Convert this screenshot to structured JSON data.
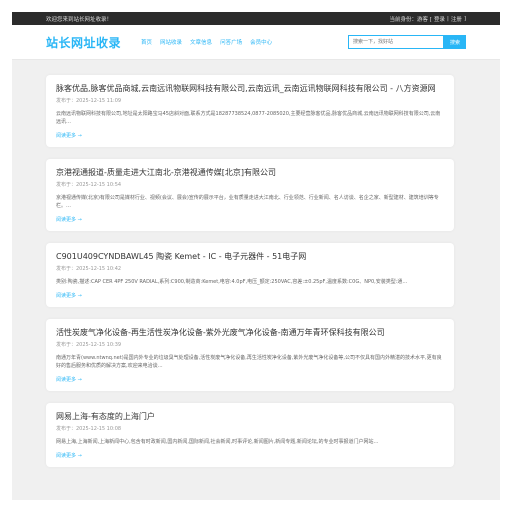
{
  "topbar": {
    "welcome": "欢迎您来到站长网址收录！",
    "identity": "当前身份：游客 [",
    "login": "登录",
    "separator": "|",
    "register": "注册",
    "close": "]"
  },
  "header": {
    "logo": "站长网址收录",
    "nav": [
      "首页",
      "网站收录",
      "文章信息",
      "问答广场",
      "会员中心"
    ],
    "search_placeholder": "搜索一下，找好站",
    "search_button": "搜索"
  },
  "articles": [
    {
      "title": "脉客优品,脉客优品商城,云南远讯物联网科技有限公司,云南远讯_云南远讯物联网科技有限公司 - 八方资源网",
      "date": "发布于：2025-12-15 11:09",
      "desc": "云南远讯物联网科技有限公司,地址是太阳路宝马45店斜对面,联系方式是18287738524,0877-2085020,主要经营脉客优品,脉客优品商城,云南远讯物联网科技有限公司,云南远讯…",
      "more": "阅读更多 →"
    },
    {
      "title": "京港视通报道-质量走进大江南北-京港视通传媒[北京]有限公司",
      "date": "发布于：2025-12-15 10:54",
      "desc": "京港视通传媒(北京)有限公司是媒材行业、视频(会议、展会)宣传的展示平台，业有质量走进大江南北、行业领范、行业新闻、名人访谈、名企之家、新型建材、建筑培训等专栏。…",
      "more": "阅读更多 →"
    },
    {
      "title": "C901U409CYNDBAWL45 陶瓷 Kemet - IC - 电子元器件 - 51电子网",
      "date": "发布于：2025-12-15 10:42",
      "desc": "类别:陶瓷,描述:CAP CER 4PF 250V RADIAL,系列:C900,制造商:Kemet,电容:4.0pF,电压_额定:250VAC,容差:±0.25pF,温度系数:C0G、NP0,安装类型:通…",
      "more": "阅读更多 →"
    },
    {
      "title": "活性炭废气净化设备-再生活性炭净化设备-紫外光废气净化设备-南通万年青环保科技有限公司",
      "date": "发布于：2025-12-15 10:39",
      "desc": "南通万年青(www.ntwnq.net)是国内外专业的垃圾臭气处理设备,活性炭废气净化设备,再生活性炭净化设备,紫外光废气净化设备等,公司不仅具有国内外精湛的技术水平,更有良好的售后服务和优质的解决方案,欢迎来电洽谈…",
      "more": "阅读更多 →"
    },
    {
      "title": "网易上海-有态度的上海门户",
      "date": "发布于：2025-12-15 10:08",
      "desc": "网易上海,上海新闻,上海新闻中心,包含有时政新闻,国内新闻,国际新闻,社会新闻,时事评论,新闻图片,新闻专题,新闻论坛,的专业时事报道门户网站…",
      "more": "阅读更多 →"
    }
  ],
  "colors": {
    "accent": "#29b6f6",
    "topbar_bg": "#2b2b2b",
    "page_bg": "#f0f0f0"
  }
}
